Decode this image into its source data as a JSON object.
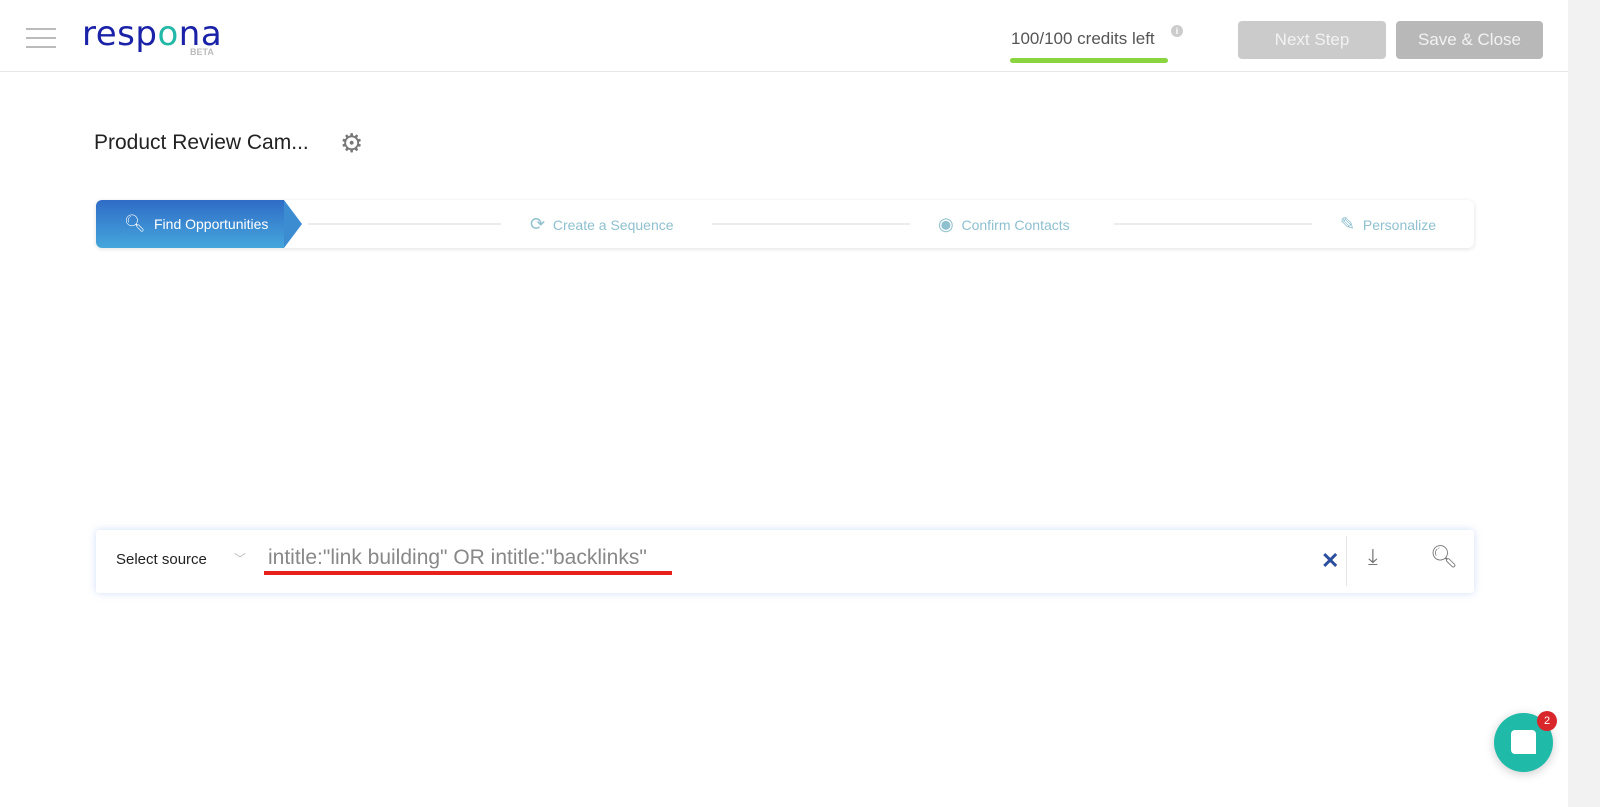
{
  "header": {
    "logo": "respona",
    "logo_badge": "BETA",
    "credits": "100/100 credits left",
    "credits_fraction": 1.0,
    "next_label": "Next Step",
    "save_label": "Save & Close",
    "credits_color": "#89d43f"
  },
  "campaign": {
    "title": "Product Review Cam..."
  },
  "steps": [
    {
      "label": "Find Opportunities",
      "icon": "search-icon",
      "active": true
    },
    {
      "label": "Create a Sequence",
      "icon": "refresh-icon"
    },
    {
      "label": "Confirm Contacts",
      "icon": "user-circle-icon"
    },
    {
      "label": "Personalize",
      "icon": "edit-icon"
    }
  ],
  "search": {
    "source_label": "Select source",
    "query": "intitle:\"link building\" OR intitle:\"backlinks\""
  },
  "chat": {
    "badge": "2"
  }
}
